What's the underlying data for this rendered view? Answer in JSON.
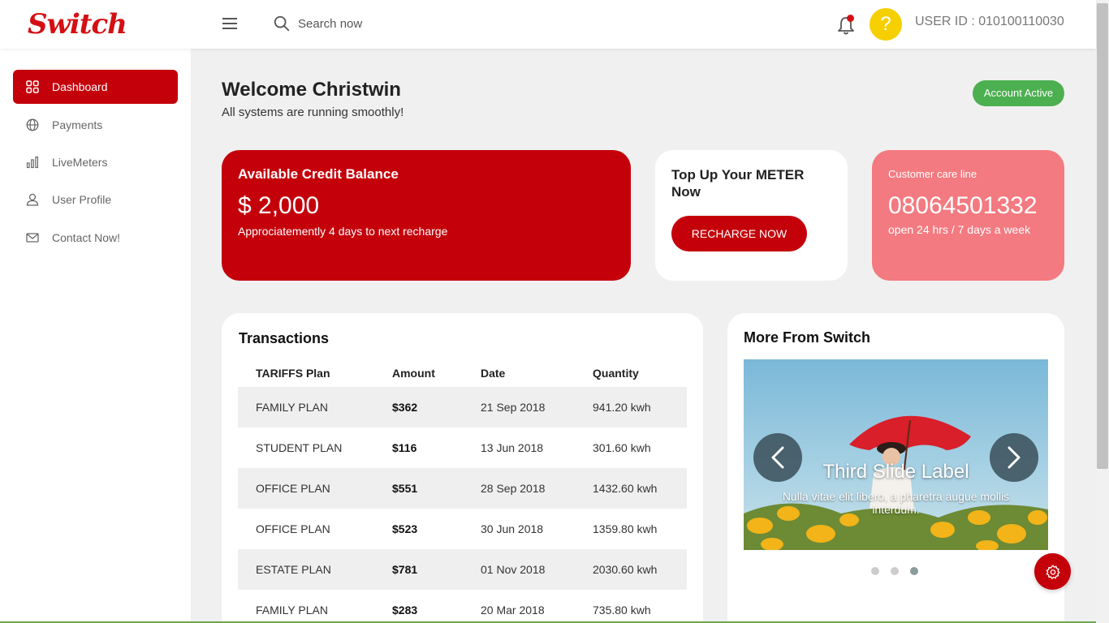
{
  "header": {
    "logo": "Switch",
    "search_placeholder": "Search now",
    "avatar_glyph": "?",
    "user_id": "USER ID : 010100110030"
  },
  "sidebar": {
    "items": [
      {
        "label": "Dashboard",
        "icon": "dashboard-grid-icon",
        "active": true
      },
      {
        "label": "Payments",
        "icon": "globe-icon"
      },
      {
        "label": "LiveMeters",
        "icon": "bar-chart-icon"
      },
      {
        "label": "User Profile",
        "icon": "user-icon"
      },
      {
        "label": "Contact Now!",
        "icon": "mail-icon"
      }
    ]
  },
  "welcome": {
    "title": "Welcome Christwin",
    "subtitle": "All systems are running smoothly!",
    "status": "Account Active"
  },
  "cards": {
    "credit": {
      "title": "Available Credit Balance",
      "amount": "$ 2,000",
      "note": "Approciatemently 4 days to next recharge"
    },
    "topup": {
      "title": "Top Up Your METER Now",
      "button": "RECHARGE NOW"
    },
    "care": {
      "label": "Customer care line",
      "number": "08064501332",
      "hours": "open 24 hrs / 7 days a week"
    }
  },
  "transactions": {
    "title": "Transactions",
    "columns": [
      "TARIFFS Plan",
      "Amount",
      "Date",
      "Quantity"
    ],
    "rows": [
      [
        "FAMILY PLAN",
        "$362",
        "21 Sep 2018",
        "941.20 kwh"
      ],
      [
        "STUDENT PLAN",
        "$116",
        "13 Jun 2018",
        "301.60 kwh"
      ],
      [
        "OFFICE PLAN",
        "$551",
        "28 Sep 2018",
        "1432.60 kwh"
      ],
      [
        "OFFICE PLAN",
        "$523",
        "30 Jun 2018",
        "1359.80 kwh"
      ],
      [
        "ESTATE PLAN",
        "$781",
        "01 Nov 2018",
        "2030.60 kwh"
      ],
      [
        "FAMILY PLAN",
        "$283",
        "20 Mar 2018",
        "735.80 kwh"
      ]
    ]
  },
  "more": {
    "title": "More From Switch",
    "slide_label": "Third Slide Label",
    "slide_caption": "Nulla vitae elit libero, a pharetra augue mollis interdum.",
    "active_slide": 3,
    "slide_count": 3
  },
  "colors": {
    "brand": "#c4000a",
    "care": "#f37a80",
    "status": "#4caf50",
    "avatar": "#f6cf00"
  }
}
